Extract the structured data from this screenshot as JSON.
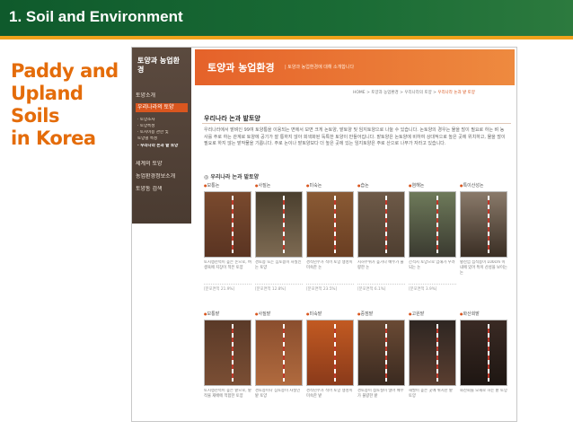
{
  "slide": {
    "title": "1. Soil and Environment",
    "heading_lines": [
      "Paddy and",
      "Upland Soils",
      "in Korea"
    ],
    "colors": {
      "header": "#1a6b35",
      "accent": "#f0a21c",
      "heading": "#e46c0a"
    }
  },
  "screenshot": {
    "sidebar": {
      "title": "토양과 농업환경",
      "items": [
        {
          "label": "토양소개",
          "active": false
        },
        {
          "label": "우리나라의 토양",
          "active": true
        }
      ],
      "subitems": [
        {
          "label": "· 토양조사",
          "highlight": false
        },
        {
          "label": "· 토양특성",
          "highlight": false
        },
        {
          "label": "· 토지이용 관한 및",
          "highlight": false
        },
        {
          "label": "  토양별 특성",
          "highlight": false
        },
        {
          "label": "· 우리나라 논과 밭 토양",
          "highlight": true
        }
      ],
      "items2": [
        {
          "label": "세계의 토양"
        },
        {
          "label": "농업환경정보소개"
        },
        {
          "label": "토양통 검색"
        }
      ]
    },
    "banner": {
      "title": "토양과 농업환경",
      "subtitle": "| 토양과 농업환경에 대해 소개합니다"
    },
    "breadcrumb": {
      "path": "HOME > 토양과 농업환경 > 우리나라의 토양 > ",
      "current": "우리나라 논과 밭 토양"
    },
    "section_title": "우리나라 논과 밭토양",
    "body_text": "우리나라에서 밭벼인 99여 토양통을 이용되는 면에서 보면 크게 논토양, 밭토양 및 임지토양으로 나눌 수 있습니다. 논토양의 경우는 물을 많이 필요로 하는 벼 농사를 주로 하는 관계로 토양에 공기가 잘 통하지 않아 회색화된 독특한 토양이 만들어집니다. 밭토양은 논토양에 비하여 상대적으로 높은 곳에 위치하고, 물을 많이 필요로 하지 않는 밭작물을 기릅니다. 주로 논이나 밭토양보다 더 높은 곳에 있는 임지토양은 주로 산으로 나무가 자라고 있습니다.",
    "subsection_title": "◎ 우리나라 논과 밭토양",
    "paddy_cards": [
      {
        "label": "보통논",
        "desc": "토지생산력이 높은 논으로, 벼 생육에 지장이 적은 토양",
        "pct": "[분포면적 21.9%]",
        "color_top": "#7a4a2e",
        "color_bottom": "#5a3422"
      },
      {
        "label": "사질논",
        "desc": "경토층 또는 심토층이 사질인 논 토양",
        "pct": "[분포면적 12.8%]",
        "color_top": "#4a3f2e",
        "color_bottom": "#7d6a52"
      },
      {
        "label": "미숙논",
        "desc": "경작년수가 적어 토양 생성이 미숙한 논",
        "pct": "[분포면적 23.5%]",
        "color_top": "#8a5a34",
        "color_bottom": "#6a3e22"
      },
      {
        "label": "습논",
        "desc": "지하수위가 높거나 배수가 불량한 논",
        "pct": "[분포면적 6.1%]",
        "color_top": "#6e5a48",
        "color_bottom": "#4e3e30"
      },
      {
        "label": "염해논",
        "desc": "간척지 토양으로 염해가 우려되는 논",
        "pct": "[분포면적 3.9%]",
        "color_top": "#6e7a5a",
        "color_bottom": "#3a3a30"
      },
      {
        "label": "특이산성논",
        "desc": "황산염 집적층이 100cm 이내에 있어 특이 산성을 보이는 논",
        "pct": "",
        "color_top": "#8a7a6a",
        "color_bottom": "#3a2e24"
      }
    ],
    "upland_cards": [
      {
        "label": "보통밭",
        "desc": "토지생산력이 높은 밭으로, 밭작물 재배에 적합한 토양",
        "pct": "",
        "color_top": "#5a3a28",
        "color_bottom": "#7a4e34"
      },
      {
        "label": "사질밭",
        "desc": "경토층이나 심토층이 사질인 밭 토양",
        "pct": "",
        "color_top": "#8a4e2e",
        "color_bottom": "#b06a3e"
      },
      {
        "label": "미숙밭",
        "desc": "경작년수가 적어 토양 생성이 미숙한 밭",
        "pct": "",
        "color_top": "#c25a22",
        "color_bottom": "#8a3a1a"
      },
      {
        "label": "중점밭",
        "desc": "경토층이 점토질이 많아 배수가 불량한 밭",
        "pct": "",
        "color_top": "#6a4a34",
        "color_bottom": "#3a2a20"
      },
      {
        "label": "고원밭",
        "desc": "해발이 높은 곳에 위치한 밭 토양",
        "pct": "",
        "color_top": "#2e2622",
        "color_bottom": "#5a3e30"
      },
      {
        "label": "화산회밭",
        "desc": "화산회를 모재로 하는 밭 토양",
        "pct": "",
        "color_top": "#3a2a24",
        "color_bottom": "#1e1612"
      }
    ]
  }
}
